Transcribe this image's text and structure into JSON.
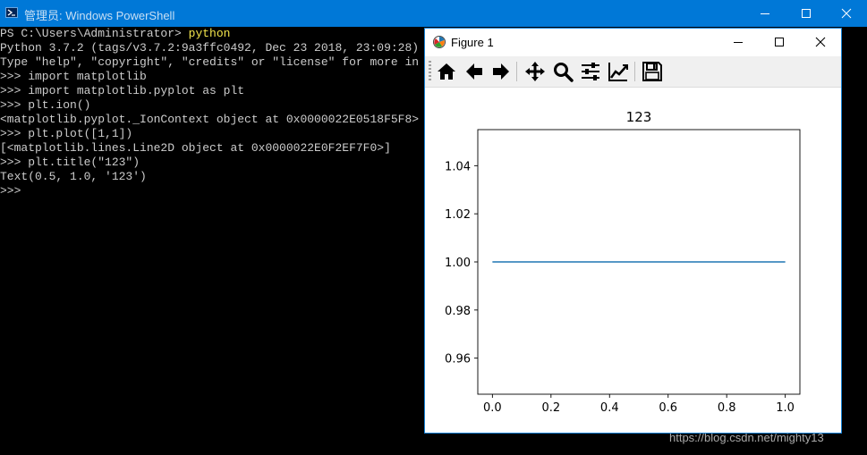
{
  "powershell": {
    "title": "管理员: Windows PowerShell",
    "lines": [
      {
        "text": "PS C:\\Users\\Administrator> ",
        "cmd": "python"
      },
      {
        "text": "Python 3.7.2 (tags/v3.7.2:9a3ffc0492, Dec 23 2018, 23:09:28)",
        "cmd": ""
      },
      {
        "text": "Type \"help\", \"copyright\", \"credits\" or \"license\" for more in",
        "cmd": ""
      },
      {
        "text": ">>> import matplotlib",
        "cmd": ""
      },
      {
        "text": ">>> import matplotlib.pyplot as plt",
        "cmd": ""
      },
      {
        "text": ">>> plt.ion()",
        "cmd": ""
      },
      {
        "text": "<matplotlib.pyplot._IonContext object at 0x0000022E0518F5F8>",
        "cmd": ""
      },
      {
        "text": ">>> plt.plot([1,1])",
        "cmd": ""
      },
      {
        "text": "[<matplotlib.lines.Line2D object at 0x0000022E0F2EF7F0>]",
        "cmd": ""
      },
      {
        "text": ">>> plt.title(\"123\")",
        "cmd": ""
      },
      {
        "text": "Text(0.5, 1.0, '123')",
        "cmd": ""
      },
      {
        "text": ">>>",
        "cmd": ""
      }
    ]
  },
  "figure_window": {
    "title": "Figure 1",
    "toolbar": [
      "home-icon",
      "back-arrow-icon",
      "forward-arrow-icon",
      "pan-icon",
      "zoom-icon",
      "subplots-icon",
      "customize-icon",
      "save-icon"
    ]
  },
  "watermark": "https://blog.csdn.net/mighty13",
  "chart_data": {
    "type": "line",
    "title": "123",
    "xlabel": "",
    "ylabel": "",
    "x": [
      0,
      1
    ],
    "series": [
      {
        "values": [
          1,
          1
        ],
        "color": "#1f77b4"
      }
    ],
    "xlim": [
      -0.05,
      1.05
    ],
    "ylim": [
      0.945,
      1.055
    ],
    "xticks": [
      0.0,
      0.2,
      0.4,
      0.6,
      0.8,
      1.0
    ],
    "xtick_labels": [
      "0.0",
      "0.2",
      "0.4",
      "0.6",
      "0.8",
      "1.0"
    ],
    "yticks": [
      0.96,
      0.98,
      1.0,
      1.02,
      1.04
    ],
    "ytick_labels": [
      "0.96",
      "0.98",
      "1.00",
      "1.02",
      "1.04"
    ],
    "grid": false
  }
}
